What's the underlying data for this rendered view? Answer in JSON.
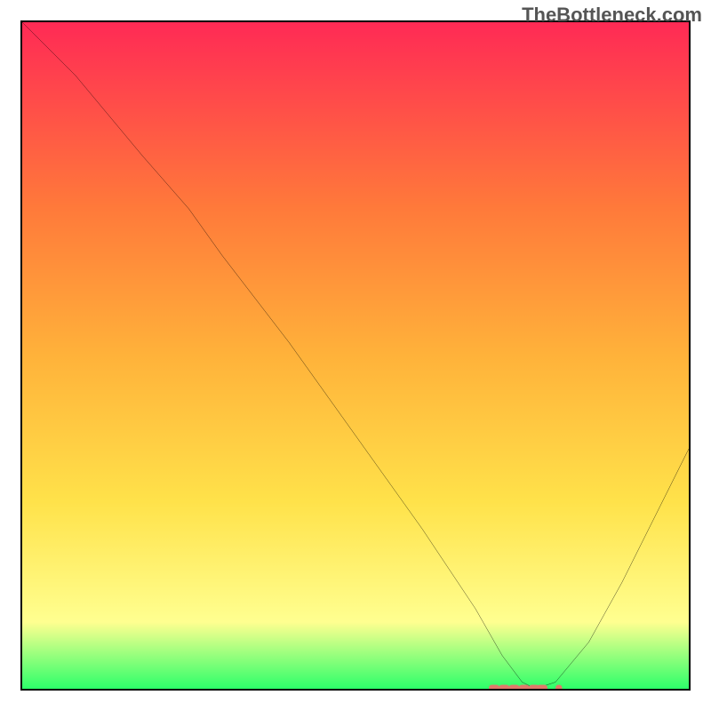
{
  "watermark": "TheBottleneck.com",
  "chart_data": {
    "type": "line",
    "title": "",
    "xlabel": "",
    "ylabel": "",
    "xlim": [
      0,
      100
    ],
    "ylim": [
      0,
      100
    ],
    "gradient_colors": {
      "top": "#ff2a55",
      "upper_mid": "#ff7a3a",
      "mid": "#ffb23a",
      "lower_mid": "#ffe24a",
      "near_bottom": "#ffff90",
      "bottom": "#2dff6a"
    },
    "curve": {
      "description": "Black curve starting at top-left, descending steeply to a minimum around x≈77 near y≈0, then rising toward the right edge.",
      "x": [
        0,
        8,
        18,
        25,
        30,
        40,
        50,
        60,
        68,
        72,
        75,
        77,
        80,
        85,
        90,
        95,
        100
      ],
      "y": [
        100,
        92,
        80,
        72,
        65,
        52,
        38,
        24,
        12,
        5,
        1,
        0,
        1,
        7,
        16,
        26,
        36
      ]
    },
    "minimum_markers": {
      "x_range": [
        70,
        80
      ],
      "y": 0,
      "color": "#e07a6a"
    }
  }
}
